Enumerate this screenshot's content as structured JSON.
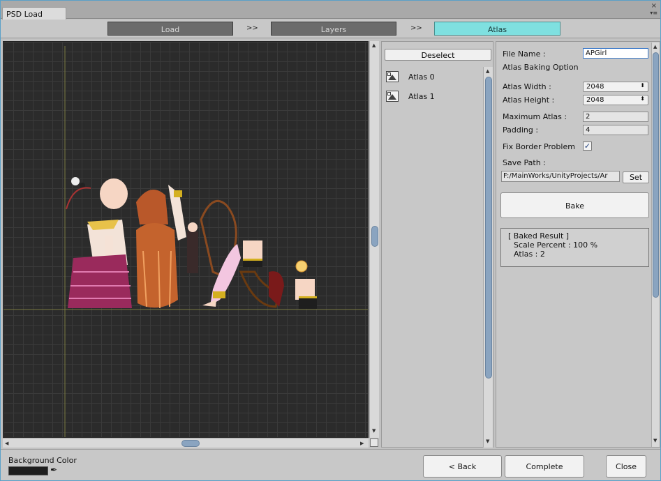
{
  "window": {
    "tab_title": "PSD Load",
    "close_glyph": "×",
    "menu_glyph": "▾≡"
  },
  "steps": [
    {
      "label": "Load",
      "state": "done"
    },
    {
      "label": "Layers",
      "state": "done"
    },
    {
      "label": "Atlas",
      "state": "active"
    }
  ],
  "step_separator": ">>",
  "list": {
    "deselect_label": "Deselect",
    "items": [
      {
        "label": "Atlas 0"
      },
      {
        "label": "Atlas 1"
      }
    ]
  },
  "options": {
    "file_name_label": "File Name :",
    "file_name_value": "APGirl",
    "baking_option_label": "Atlas Baking Option",
    "atlas_width_label": "Atlas Width :",
    "atlas_width_value": "2048",
    "atlas_height_label": "Atlas Height :",
    "atlas_height_value": "2048",
    "max_atlas_label": "Maximum Atlas :",
    "max_atlas_value": "2",
    "padding_label": "Padding :",
    "padding_value": "4",
    "fix_border_label": "Fix Border Problem",
    "fix_border_checked": true,
    "save_path_label": "Save Path :",
    "save_path_value": "F:/MainWorks/UnityProjects/Ar",
    "set_label": "Set",
    "bake_label": "Bake",
    "result_title": "[ Baked Result ]",
    "result_scale": "Scale Percent : 100 %",
    "result_atlas": "Atlas : 2"
  },
  "bottom": {
    "bg_color_label": "Background Color",
    "bg_color_value": "#1e1e1e",
    "back_label": "< Back",
    "complete_label": "Complete",
    "close_label": "Close"
  },
  "colors": {
    "accent_step": "#7fe0e0",
    "canvas_bg": "#2b2b2b",
    "panel_bg": "#c8c8c8"
  },
  "icons": {
    "eyedropper": "eyedropper-icon",
    "atlas_item": "image-icon"
  }
}
